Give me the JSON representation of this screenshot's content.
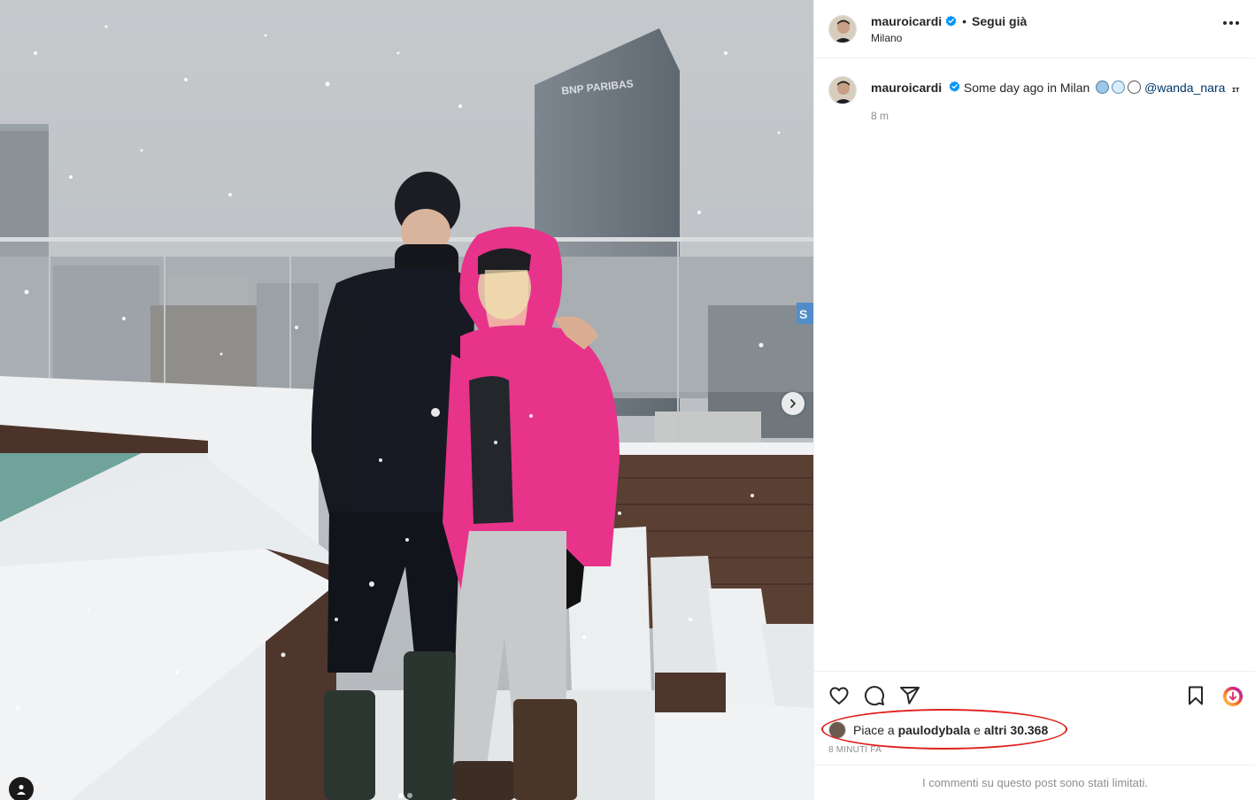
{
  "post": {
    "username": "mauroicardi",
    "follow_label": "Segui già",
    "separator": "•",
    "location": "Milano",
    "more_label": "Altre opzioni"
  },
  "caption": {
    "username": "mauroicardi",
    "text": "Some day ago in Milan",
    "emojis": [
      "cold-face-emoji",
      "snowflake-emoji",
      "snowman-emoji"
    ],
    "mention": "@wanda_nara",
    "translate_badge": "ɪᴛ",
    "time": "8 m"
  },
  "photo": {
    "building_sign": "BNP PARIBAS",
    "side_sign": "S",
    "carousel_dots": 2,
    "active_dot": 0
  },
  "actions": {
    "icons": [
      "heart-icon",
      "comment-icon",
      "share-icon",
      "bookmark-icon",
      "boost-icon"
    ]
  },
  "likes": {
    "prefix": "Piace a",
    "liker": "paulodybala",
    "middle": "e",
    "others": "altri 30.368"
  },
  "time_ago": "8 MINUTI FA",
  "comments_limited": "I commenti su questo post sono stati limitati.",
  "colors": {
    "verified": "#0095f6",
    "annotation_circle": "#e0201c",
    "mention": "#00376b",
    "jacket": "#e8338a"
  }
}
